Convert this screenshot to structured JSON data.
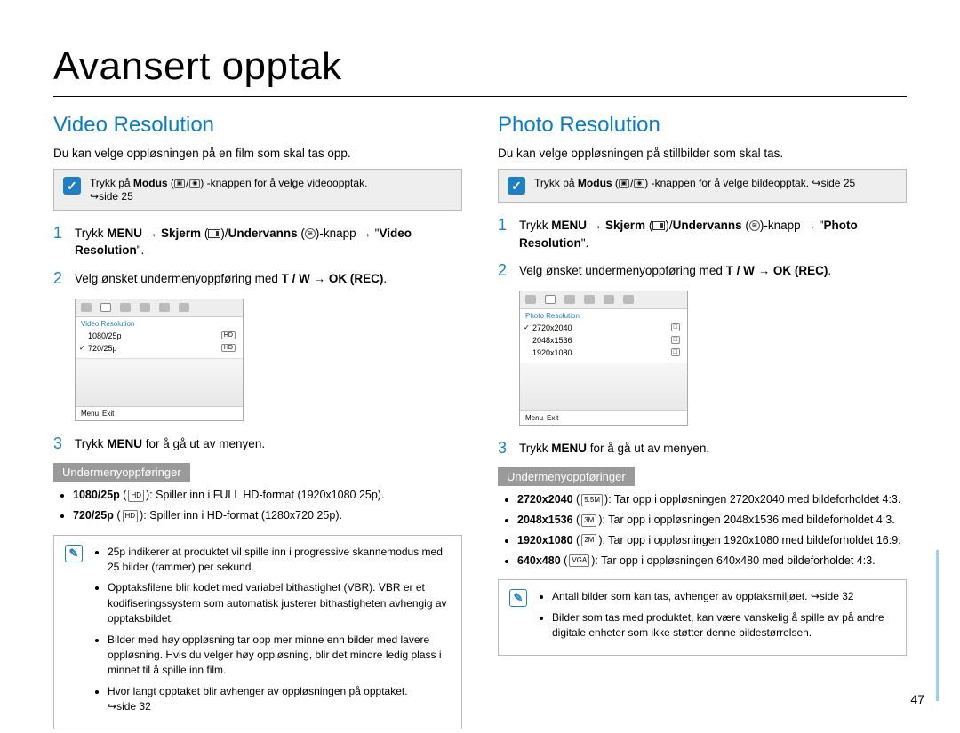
{
  "pageTitle": "Avansert opptak",
  "pageNumber": "47",
  "left": {
    "heading": "Video Resolution",
    "lead": "Du kan velge oppløsningen på en film som skal tas opp.",
    "tip": {
      "prefix": "Trykk på ",
      "modus": "Modus",
      "suffix": "-knappen for å velge videoopptak.",
      "ref": "side 25"
    },
    "steps": {
      "s1": {
        "trykk": "Trykk ",
        "menu": "MENU",
        "arrow1": " → ",
        "skjerm": "Skjerm",
        "sep": "/",
        "undervanns": "Undervanns",
        "arrow2": "-knapp → ",
        "quoteOpen": "\"",
        "target": "Video Resolution",
        "quoteClose": "\"."
      },
      "s2": {
        "text": "Velg ønsket undermenyoppføring med ",
        "tw": "T / W",
        "arrow": " → ",
        "ok": "OK (REC)",
        "end": "."
      },
      "s3": {
        "prefix": "Trykk ",
        "menu": "MENU",
        "suffix": " for å gå ut av menyen."
      }
    },
    "ui": {
      "title": "Video Resolution",
      "opt1": "1080/25p",
      "badge1": "HD",
      "opt2": "720/25p",
      "badge2": "HD",
      "exit": "Exit",
      "menu": "Menu"
    },
    "sublist_heading": "Undermenyoppføringer",
    "sublist": {
      "a_label": "1080/25p",
      "a_badge": "HD",
      "a_desc": ": Spiller inn i FULL HD-format (1920x1080 25p).",
      "b_label": "720/25p",
      "b_badge": "HD",
      "b_desc": ": Spiller inn i HD-format (1280x720 25p)."
    },
    "notes": {
      "n1": "25p indikerer at produktet vil spille inn i progressive skannemodus med 25 bilder (rammer) per sekund.",
      "n2": "Opptaksfilene blir kodet med variabel bithastighet (VBR). VBR er et kodifiseringssystem som automatisk justerer bithastigheten avhengig av opptaksbildet.",
      "n3": "Bilder med høy oppløsning tar opp mer minne enn bilder med lavere oppløsning. Hvis du velger høy oppløsning, blir det mindre ledig plass i minnet til å spille inn film.",
      "n4_text": "Hvor langt opptaket blir avhenger av oppløsningen på opptaket.",
      "n4_ref": "side 32"
    }
  },
  "right": {
    "heading": "Photo Resolution",
    "lead": "Du kan velge oppløsningen på stillbilder som skal tas.",
    "tip": {
      "prefix": "Trykk på ",
      "modus": "Modus",
      "suffix": "-knappen for å velge bildeopptak. ",
      "ref": "side 25"
    },
    "steps": {
      "s1": {
        "trykk": "Trykk ",
        "menu": "MENU",
        "arrow1": " → ",
        "skjerm": "Skjerm",
        "sep": "/",
        "undervanns": "Undervanns",
        "arrow2": "-knapp → ",
        "quoteOpen": "\"",
        "target": "Photo Resolution",
        "quoteClose": "\"."
      },
      "s2": {
        "text": "Velg ønsket undermenyoppføring med ",
        "tw": "T / W",
        "arrow": " → ",
        "ok": "OK (REC)",
        "end": "."
      },
      "s3": {
        "prefix": "Trykk ",
        "menu": "MENU",
        "suffix": " for å gå ut av menyen."
      }
    },
    "ui": {
      "title": "Photo Resolution",
      "opt1": "2720x2040",
      "opt2": "2048x1536",
      "opt3": "1920x1080",
      "exit": "Exit",
      "menu": "Menu"
    },
    "sublist_heading": "Undermenyoppføringer",
    "sublist": {
      "a_label": "2720x2040",
      "a_badge": "5.5M",
      "a_desc": ": Tar opp i oppløsningen 2720x2040 med bildeforholdet 4:3.",
      "b_label": "2048x1536",
      "b_badge": "3M",
      "b_desc": ": Tar opp i oppløsningen 2048x1536 med bildeforholdet 4:3.",
      "c_label": "1920x1080",
      "c_badge": "2M",
      "c_desc": ": Tar opp i oppløsningen 1920x1080 med bildeforholdet 16:9.",
      "d_label": "640x480",
      "d_badge": "VGA",
      "d_desc": ": Tar opp i oppløsningen 640x480 med bildeforholdet 4:3."
    },
    "notes": {
      "n1_text": "Antall bilder som kan tas, avhenger av opptaksmiljøet. ",
      "n1_ref": "side 32",
      "n2": "Bilder som tas med produktet, kan være vanskelig å spille av på andre digitale enheter som ikke støtter denne bildestørrelsen."
    }
  }
}
